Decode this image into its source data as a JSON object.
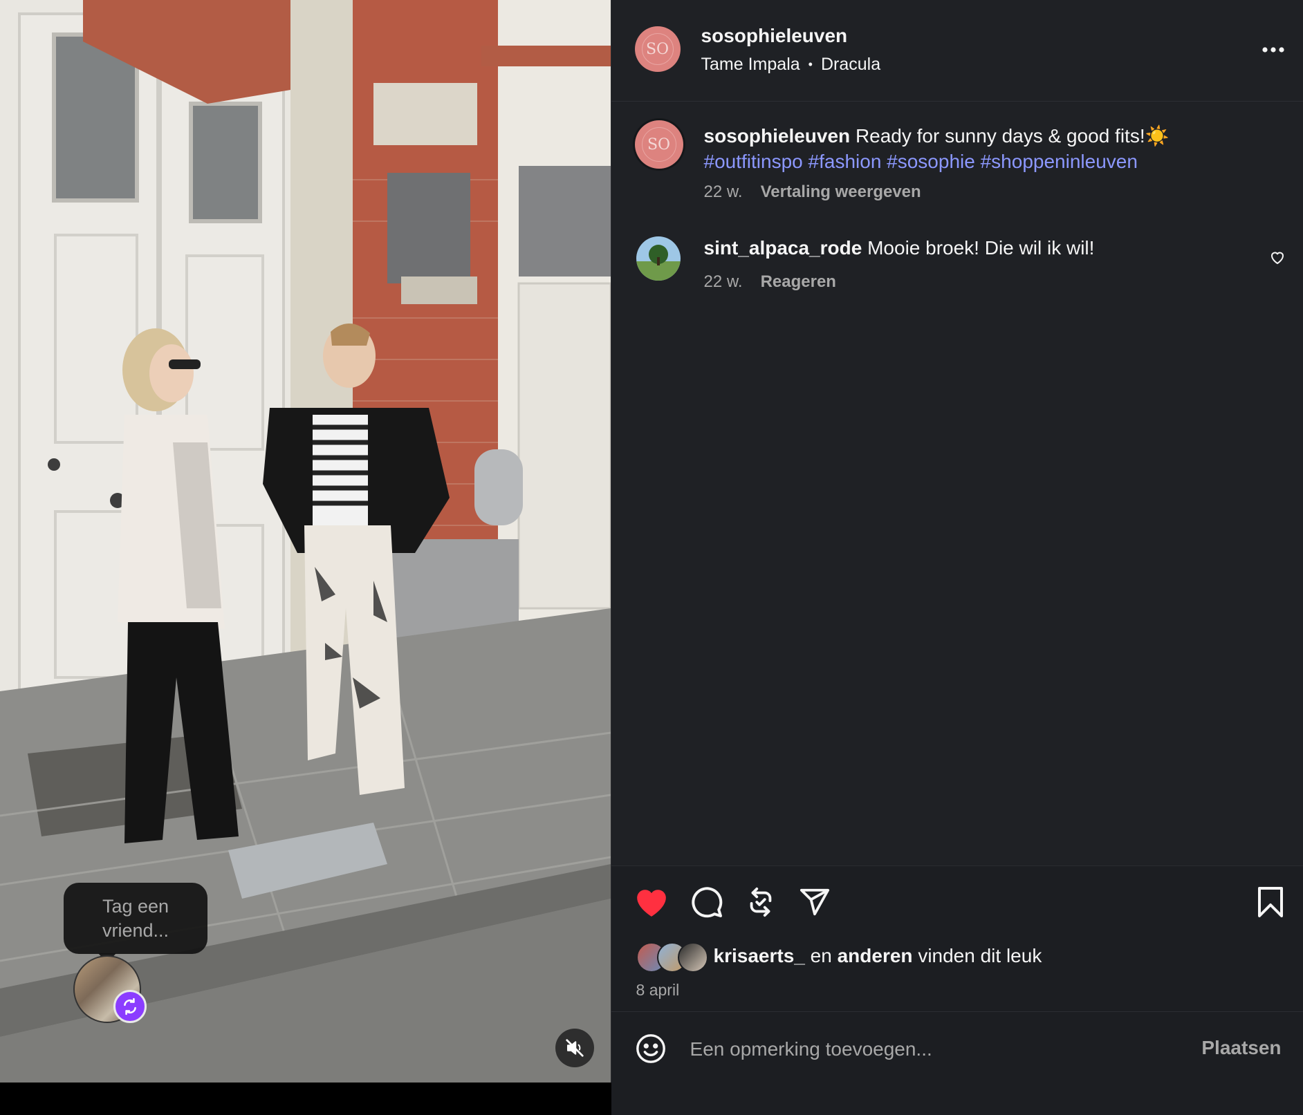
{
  "post": {
    "username": "sosophieleuven",
    "audio_artist": "Tame Impala",
    "audio_separator": "•",
    "audio_track": "Dracula",
    "avatar_text": "SO"
  },
  "caption": {
    "username": "sosophieleuven",
    "text": "Ready for sunny days & good fits!☀️",
    "hashtags": "#outfitinspo #fashion #sosophie #shoppeninleuven",
    "age": "22 w.",
    "translate_label": "Vertaling weergeven"
  },
  "comments": [
    {
      "username": "sint_alpaca_rode",
      "text": "Mooie broek! Die wil ik wil!",
      "age": "22 w.",
      "reply_label": "Reageren"
    }
  ],
  "media": {
    "tag_prompt": "Tag een vriend..."
  },
  "likes": {
    "first_user": "krisaerts_",
    "connector": "en",
    "others": "anderen",
    "suffix": "vinden dit leuk",
    "date": "8 april"
  },
  "comment_box": {
    "placeholder": "Een opmerking toevoegen...",
    "post_label": "Plaatsen"
  },
  "colors": {
    "like_active": "#ff3040",
    "hashtag": "#8c98ff",
    "avatar_brand": "#dd837f",
    "panel_bg": "#1f2125"
  },
  "icons": {
    "header_more": "more-icon",
    "like": "heart-filled-icon",
    "comment": "comment-icon",
    "repost": "repost-icon",
    "share": "share-icon",
    "save": "bookmark-icon",
    "emoji": "emoji-icon",
    "mute": "speaker-muted-icon"
  }
}
